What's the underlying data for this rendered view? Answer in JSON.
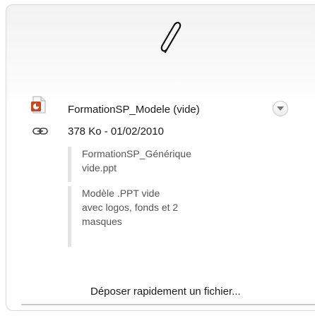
{
  "attachment": {
    "file_name": "FormationSP_Modele (vide)",
    "file_meta": "378 Ko - 01/02/2010",
    "document_name_line1": "FormationSP_Générique",
    "document_name_line2": "vide.ppt",
    "description_line1": "Modèle .PPT vide",
    "description_line2": "avec logos, fonds et 2",
    "description_line3": "masques"
  },
  "actions": {
    "quick_upload_label": "Déposer rapidement un fichier..."
  },
  "icons": {
    "header": "paperclip-icon",
    "file_type": "powerpoint-file-icon",
    "link": "link-icon",
    "menu": "chevron-down-icon"
  },
  "colors": {
    "powerpoint": "#c8471e",
    "border": "#d8d8d8"
  }
}
